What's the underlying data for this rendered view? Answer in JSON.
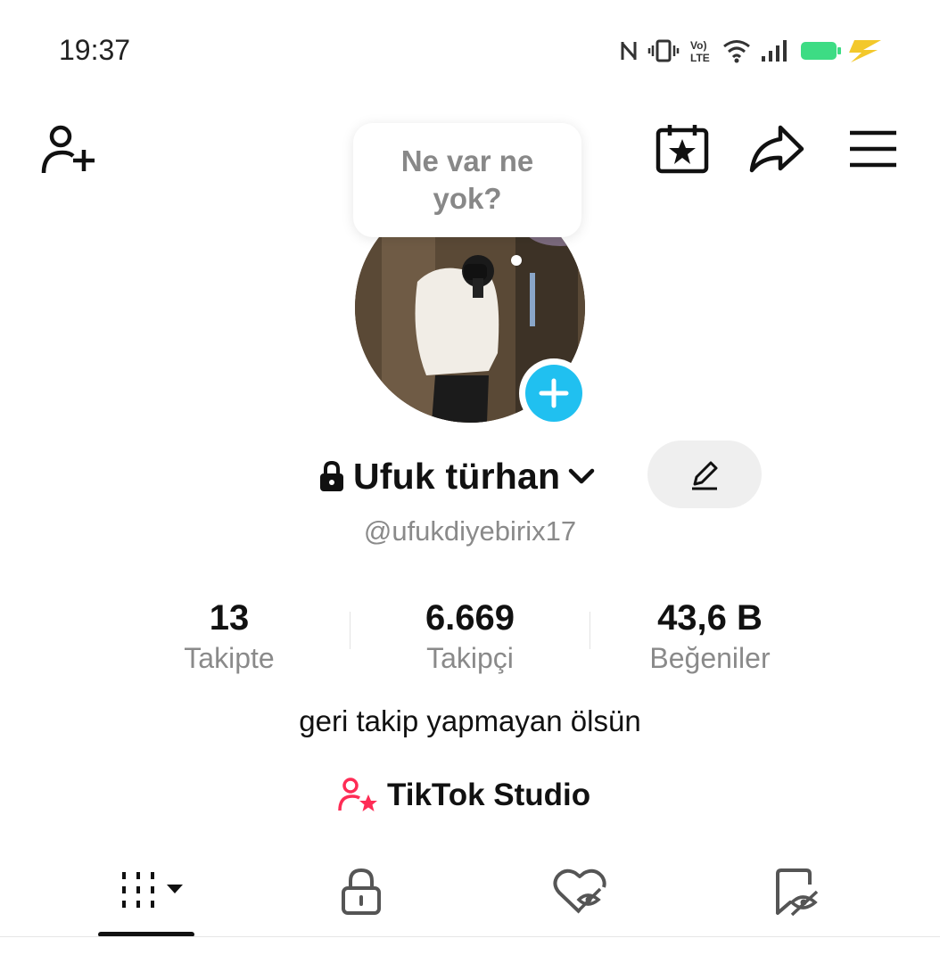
{
  "status_bar": {
    "time": "19:37",
    "icons": [
      "nfc-icon",
      "vibrate-icon",
      "volte-icon",
      "wifi-icon",
      "signal-icon",
      "battery-charging-icon"
    ],
    "battery_color": "#3ddc84"
  },
  "header": {
    "icons": [
      "add-friend-icon",
      "calendar-star-icon",
      "share-icon",
      "menu-icon"
    ]
  },
  "bubble": {
    "text": "Ne var ne yok?"
  },
  "profile": {
    "name": "Ufuk türhan",
    "handle": "@ufukdiyebirix17",
    "bio": "geri takip yapmayan ölsün",
    "accent": "#20c0f0"
  },
  "stats": [
    {
      "value": "13",
      "label": "Takipte"
    },
    {
      "value": "6.669",
      "label": "Takipçi"
    },
    {
      "value": "43,6 B",
      "label": "Beğeniler"
    }
  ],
  "studio": {
    "label": "TikTok Studio",
    "icon_color": "#fe2c55"
  },
  "tabs": [
    "videos-grid-icon",
    "lock-icon",
    "liked-hidden-icon",
    "favorites-hidden-icon"
  ]
}
